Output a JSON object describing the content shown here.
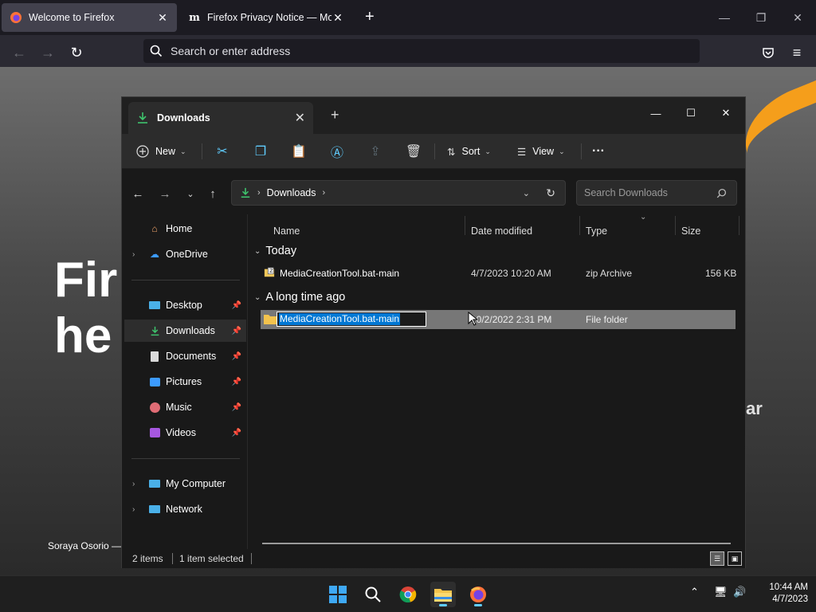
{
  "browser": {
    "tabs": [
      {
        "title": "Welcome to Firefox",
        "active": true
      },
      {
        "title": "Firefox Privacy Notice — Mozill",
        "active": false
      }
    ],
    "new_tab_glyph": "+",
    "url_placeholder": "Search or enter address",
    "page": {
      "hero_line1": "Fir",
      "hero_line2": "he",
      "side_text": "ar",
      "credit": "Soraya Osorio —"
    }
  },
  "explorer": {
    "tab_title": "Downloads",
    "toolbar": {
      "new_label": "New",
      "sort_label": "Sort",
      "view_label": "View",
      "more_glyph": "···"
    },
    "address": {
      "location": "Downloads",
      "search_placeholder": "Search Downloads"
    },
    "nav": {
      "home": "Home",
      "onedrive": "OneDrive",
      "quick": [
        {
          "label": "Desktop",
          "icon": "desktop-icon"
        },
        {
          "label": "Downloads",
          "icon": "download-icon",
          "selected": true
        },
        {
          "label": "Documents",
          "icon": "document-icon"
        },
        {
          "label": "Pictures",
          "icon": "pictures-icon"
        },
        {
          "label": "Music",
          "icon": "music-icon"
        },
        {
          "label": "Videos",
          "icon": "videos-icon"
        }
      ],
      "my_computer": "My Computer",
      "network": "Network"
    },
    "columns": [
      "Name",
      "Date modified",
      "Type",
      "Size"
    ],
    "groups": [
      {
        "label": "Today",
        "files": [
          {
            "name": "MediaCreationTool.bat-main",
            "date": "4/7/2023 10:20 AM",
            "type": "zip Archive",
            "size": "156 KB",
            "icon": "zip-icon"
          }
        ]
      },
      {
        "label": "A long time ago",
        "files": [
          {
            "name": "MediaCreationTool.bat-main",
            "date": "10/2/2022 2:31 PM",
            "type": "File folder",
            "size": "",
            "icon": "folder-icon",
            "selected": true,
            "renaming": true
          }
        ]
      }
    ],
    "status": {
      "items": "2 items",
      "selected": "1 item selected"
    }
  },
  "taskbar": {
    "time": "10:44 AM",
    "date": "4/7/2023"
  },
  "colors": {
    "accent": "#60cdff",
    "selection": "#0078d4",
    "firefox_orange": "#f59e1b"
  }
}
